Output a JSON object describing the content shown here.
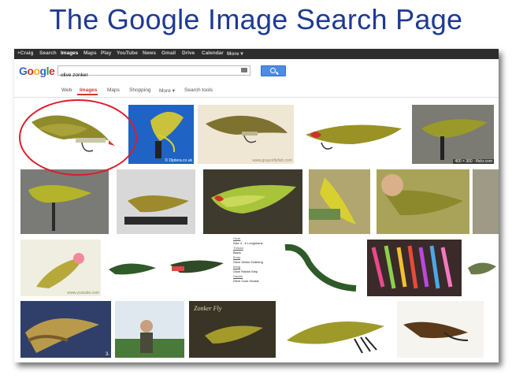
{
  "slide": {
    "title": "The Google Image Search Page"
  },
  "topbar": {
    "items": [
      "+Craig",
      "Search",
      "Images",
      "Maps",
      "Play",
      "YouTube",
      "News",
      "Gmail",
      "Drive",
      "Calendar",
      "More ▾"
    ]
  },
  "logo": [
    "G",
    "o",
    "o",
    "g",
    "l",
    "e"
  ],
  "search": {
    "query": "olive zonker",
    "button_icon": "search-icon",
    "camera_icon": "camera-icon"
  },
  "tabs": [
    "Web",
    "Images",
    "Maps",
    "Shopping",
    "More ▾",
    "Search tools"
  ],
  "results": {
    "captions": [
      "© Diptera.co.uk",
      "www.grayceflyfish.com",
      "400 × 300 - flickr.com",
      "www.youtube.com",
      "3."
    ],
    "menu": [
      "Hook",
      "Size 4 - 6 Longshank",
      "Thread",
      "Black",
      "Body",
      "Olive Glister Dubbing",
      "Wing",
      "Olive Rabbit Strip",
      "Hackle",
      "Olive Cock Hackle"
    ]
  },
  "colors": {
    "title": "#1f3a93",
    "gbar": "#2d2d2d",
    "active_tab": "#cc3d2a",
    "search_button": "#4d8ce4",
    "highlight": "#d91f2a"
  }
}
